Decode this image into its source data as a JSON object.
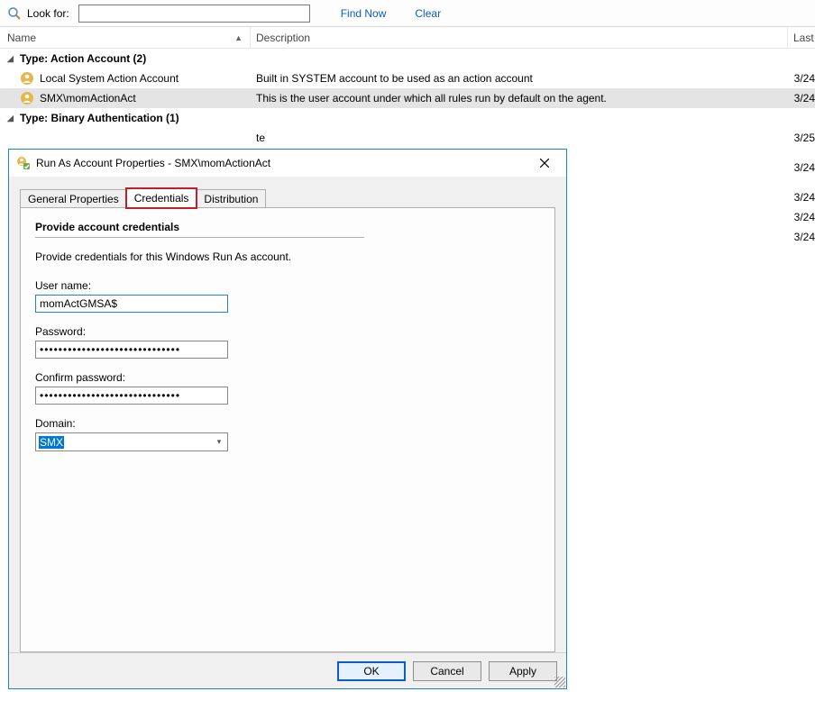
{
  "toolbar": {
    "look_for_label": "Look for:",
    "search_value": "",
    "find_now": "Find Now",
    "clear": "Clear"
  },
  "columns": {
    "name": "Name",
    "description": "Description",
    "last": "Last"
  },
  "groups": {
    "action": {
      "label": "Type: Action Account (2)",
      "rows": [
        {
          "name": "Local System Action Account",
          "desc": "Built in SYSTEM account to be used as an action account",
          "last": "3/24"
        },
        {
          "name": "SMX\\momActionAct",
          "desc": "This is the user account under which all rules run by default on the agent.",
          "last": "3/24"
        }
      ]
    },
    "binary": {
      "label": "Type: Binary Authentication (1)",
      "rows": [
        {
          "name": "",
          "desc": "",
          "last": "3/25"
        }
      ]
    },
    "hidden_dates": [
      "3/24",
      "3/24",
      "3/24",
      "3/24"
    ]
  },
  "dialog": {
    "title": "Run As Account Properties - SMX\\momActionAct",
    "tabs": {
      "general": "General Properties",
      "credentials": "Credentials",
      "distribution": "Distribution"
    },
    "panel_title": "Provide account credentials",
    "hint": "Provide credentials for this Windows Run As account.",
    "labels": {
      "username": "User name:",
      "password": "Password:",
      "confirm": "Confirm password:",
      "domain": "Domain:"
    },
    "values": {
      "username": "momActGMSA$",
      "password": "••••••••••••••••••••••••••••••",
      "confirm": "••••••••••••••••••••••••••••••",
      "domain": "SMX"
    },
    "buttons": {
      "ok": "OK",
      "cancel": "Cancel",
      "apply": "Apply"
    }
  }
}
